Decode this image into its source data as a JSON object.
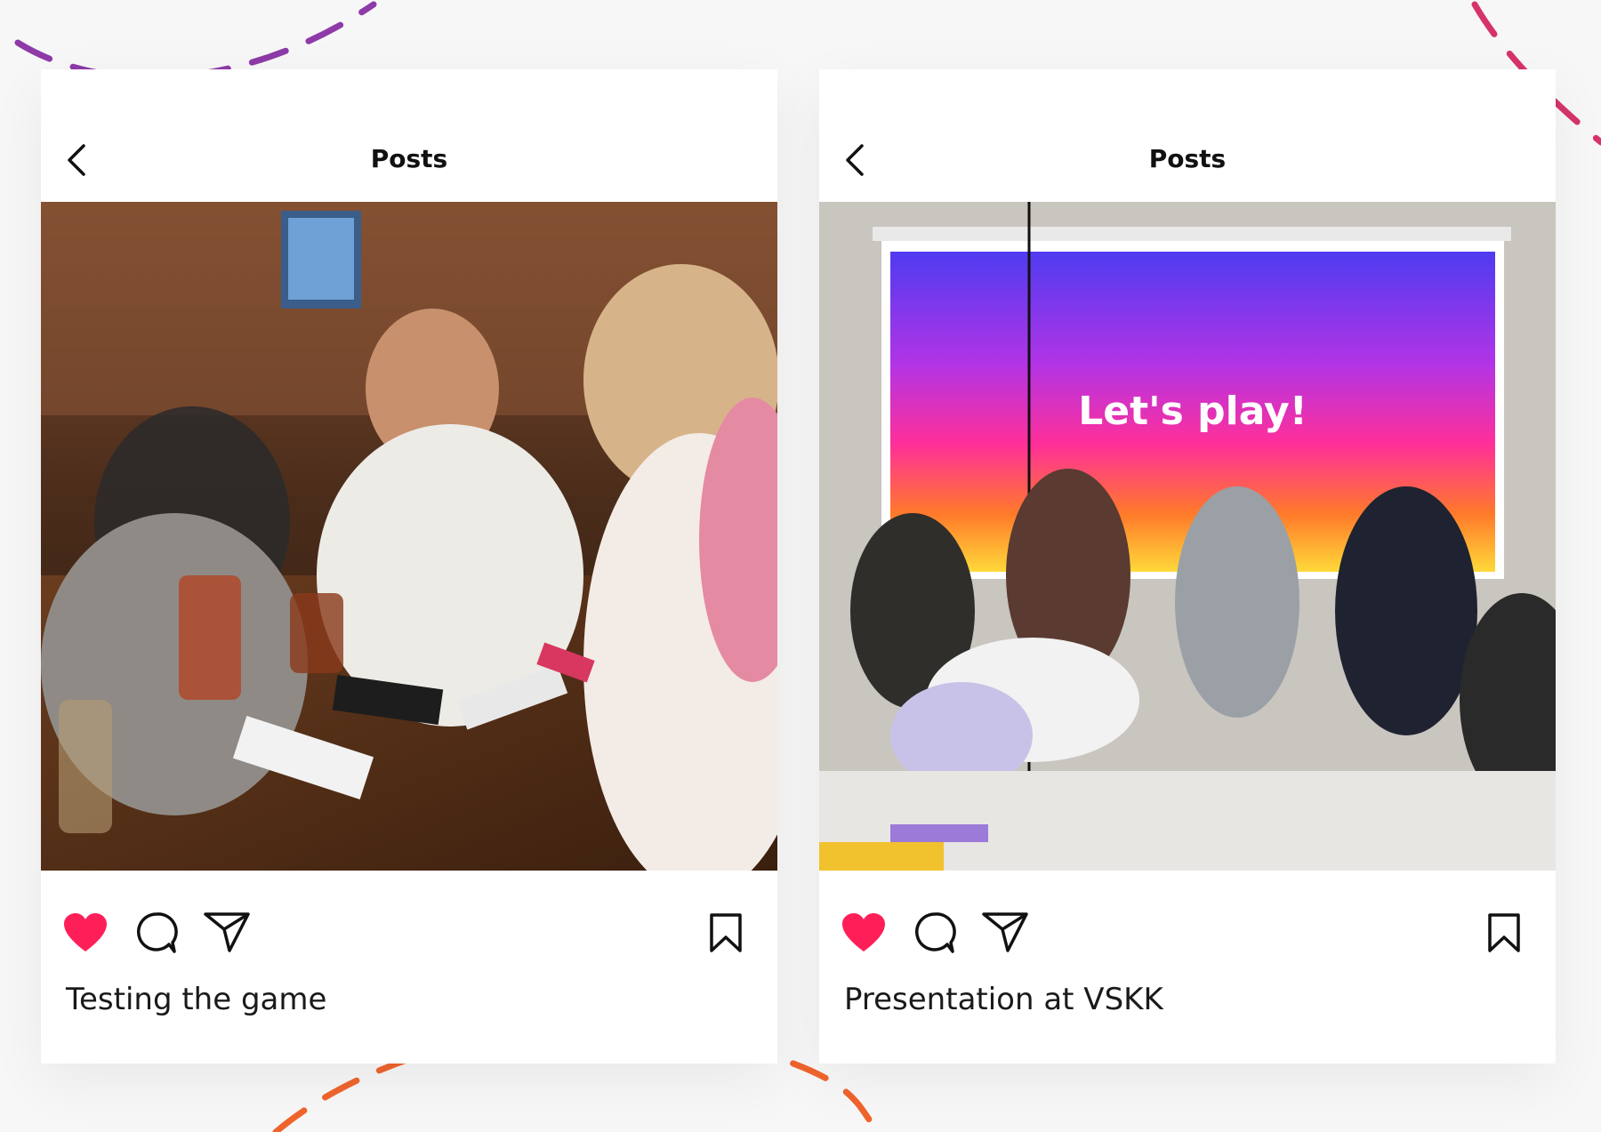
{
  "posts": [
    {
      "header_title": "Posts",
      "caption": "Testing the game",
      "photo_description_icon": "photo-group-playing-card-game"
    },
    {
      "header_title": "Posts",
      "caption": "Presentation at VSKK",
      "slide_text": "Let's play!",
      "photo_description_icon": "photo-presentation-room"
    }
  ],
  "colors": {
    "like": "#ff1f58",
    "dash_purple": "#7a3fb0",
    "dash_magenta": "#d6336c",
    "dash_orange": "#f0642d",
    "dash_yellow": "#f7c648"
  },
  "icons": {
    "back": "chevron-left-icon",
    "like": "heart-icon",
    "comment": "comment-bubble-icon",
    "share": "paper-plane-icon",
    "save": "bookmark-icon"
  }
}
